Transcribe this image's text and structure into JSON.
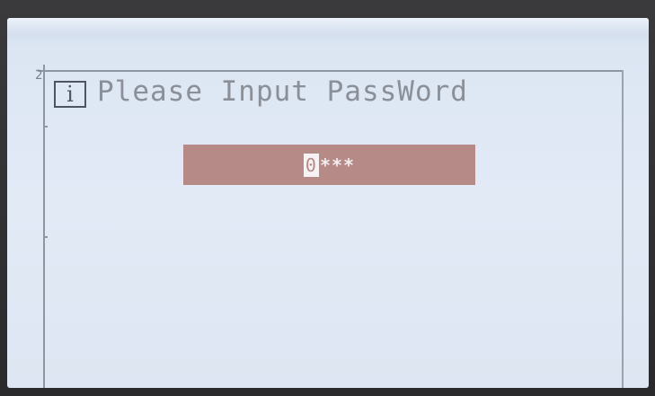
{
  "screen": {
    "corner_digit": "2",
    "info_icon": "info-icon",
    "prompt": "Please Input PassWord",
    "password": {
      "cursor_char": "0",
      "masked": "***"
    }
  },
  "colors": {
    "screen_bg": "#e2eaf6",
    "field_bg": "#b58a87",
    "prompt_text": "#8a8f98",
    "frame": "#8e96a3"
  }
}
